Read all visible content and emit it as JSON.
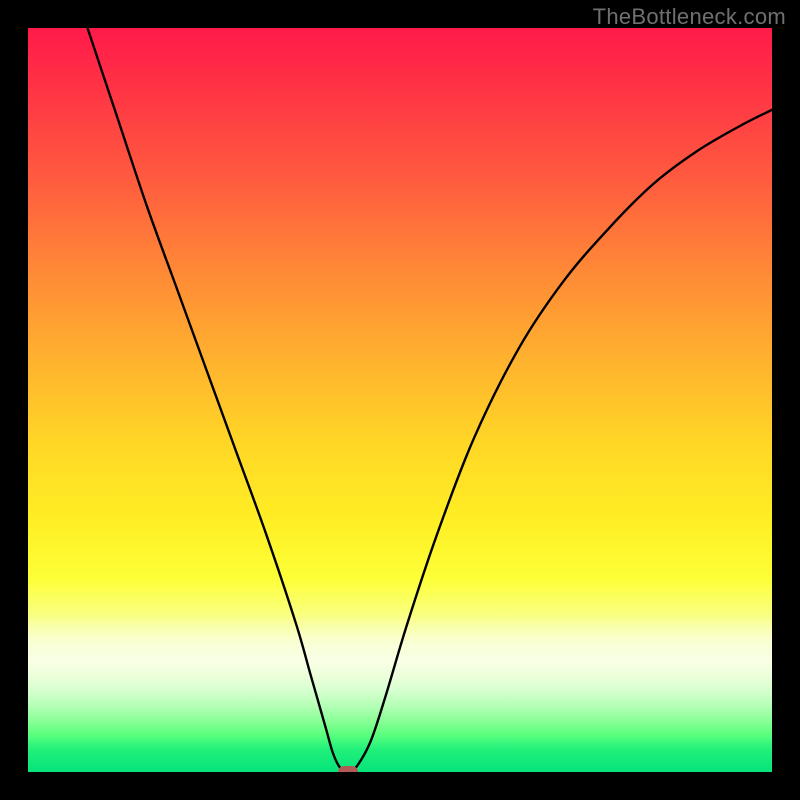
{
  "watermark": "TheBottleneck.com",
  "chart_data": {
    "type": "line",
    "title": "",
    "xlabel": "",
    "ylabel": "",
    "xlim": [
      0,
      100
    ],
    "ylim": [
      0,
      100
    ],
    "grid": false,
    "legend": false,
    "background_gradient": {
      "direction": "vertical",
      "stops": [
        {
          "pos": 0,
          "color": "#ff1a4a"
        },
        {
          "pos": 20,
          "color": "#ff5a3f"
        },
        {
          "pos": 45,
          "color": "#ffb32e"
        },
        {
          "pos": 66,
          "color": "#ffee24"
        },
        {
          "pos": 82,
          "color": "#f7ffb0"
        },
        {
          "pos": 91,
          "color": "#b6ffb8"
        },
        {
          "pos": 100,
          "color": "#06e37b"
        }
      ]
    },
    "series": [
      {
        "name": "bottleneck-curve",
        "x": [
          8,
          12,
          16,
          20,
          24,
          28,
          32,
          36,
          38,
          40,
          41,
          42,
          43,
          44,
          46,
          48,
          51,
          55,
          60,
          66,
          72,
          78,
          84,
          90,
          96,
          100
        ],
        "y": [
          100,
          88,
          76,
          65,
          54,
          43,
          32,
          20,
          13,
          6,
          2.5,
          0.5,
          0,
          0.5,
          4,
          10,
          20,
          32,
          45,
          57,
          66,
          73,
          79,
          83.5,
          87,
          89
        ]
      }
    ],
    "marker": {
      "x": 43,
      "y": 0,
      "color": "#b25a55",
      "shape": "pill"
    },
    "minimum_point": {
      "x": 43,
      "y": 0
    }
  },
  "colors": {
    "frame": "#000000",
    "curve": "#000000",
    "marker": "#b25a55",
    "watermark": "#707070"
  }
}
